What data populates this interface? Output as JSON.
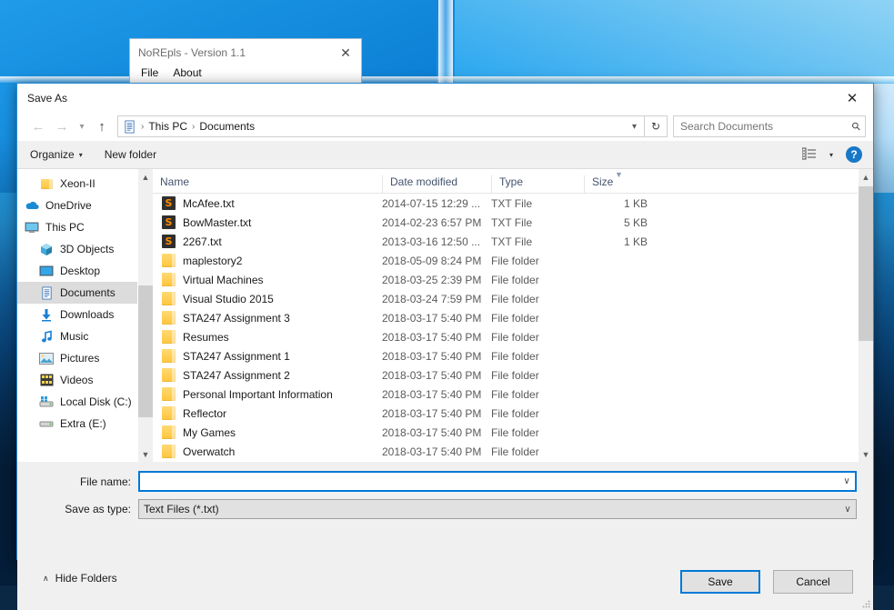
{
  "desktop": {
    "wallpaper_top": "#1b9ae8",
    "wallpaper_bottom": "#04203f"
  },
  "background_window": {
    "title": "NoREpls - Version 1.1",
    "close_icon": "close-icon",
    "menu": [
      {
        "label": "File"
      },
      {
        "label": "About"
      }
    ]
  },
  "dialog": {
    "title": "Save As",
    "close_icon": "close-icon",
    "accent": "#0078d7",
    "nav": {
      "back_icon": "arrow-left-icon",
      "forward_icon": "arrow-right-icon",
      "history_icon": "chevron-down-icon",
      "up_icon": "arrow-up-icon",
      "address_icon": "documents-icon",
      "breadcrumbs": [
        "This PC",
        "Documents"
      ],
      "separator": "›",
      "dropdown_icon": "chevron-down-icon",
      "refresh_icon": "refresh-icon",
      "refresh_glyph": "↻"
    },
    "search": {
      "placeholder": "Search Documents",
      "value": "",
      "icon": "search-icon"
    },
    "commandbar": {
      "organize_label": "Organize",
      "organize_caret": "▾",
      "new_folder_label": "New folder",
      "view_icon": "view-options-icon",
      "view_caret": "▾",
      "help_icon": "help-icon",
      "help_glyph": "?"
    },
    "sidebar": {
      "items": [
        {
          "label": "Xeon-II",
          "icon": "folder-icon",
          "indent": true,
          "selected": false
        },
        {
          "label": "OneDrive",
          "icon": "onedrive-icon",
          "indent": false,
          "selected": false
        },
        {
          "label": "This PC",
          "icon": "this-pc-icon",
          "indent": false,
          "selected": false
        },
        {
          "label": "3D Objects",
          "icon": "3d-objects-icon",
          "indent": true,
          "selected": false
        },
        {
          "label": "Desktop",
          "icon": "desktop-icon",
          "indent": true,
          "selected": false
        },
        {
          "label": "Documents",
          "icon": "documents-icon",
          "indent": true,
          "selected": true
        },
        {
          "label": "Downloads",
          "icon": "downloads-icon",
          "indent": true,
          "selected": false
        },
        {
          "label": "Music",
          "icon": "music-icon",
          "indent": true,
          "selected": false
        },
        {
          "label": "Pictures",
          "icon": "pictures-icon",
          "indent": true,
          "selected": false
        },
        {
          "label": "Videos",
          "icon": "videos-icon",
          "indent": true,
          "selected": false
        },
        {
          "label": "Local Disk (C:)",
          "icon": "local-disk-icon",
          "indent": true,
          "selected": false
        },
        {
          "label": "Extra (E:)",
          "icon": "drive-icon",
          "indent": true,
          "selected": false
        }
      ],
      "scrollbar": {
        "up_icon": "chevron-up-icon",
        "down_icon": "chevron-down-icon"
      }
    },
    "filelist": {
      "columns": [
        {
          "label": "Name"
        },
        {
          "label": "Date modified",
          "sorted": true,
          "sort_icon": "sort-ascending-icon"
        },
        {
          "label": "Type"
        },
        {
          "label": "Size"
        }
      ],
      "rows": [
        {
          "name": "McAfee.txt",
          "date": "2014-07-15 12:29 ...",
          "type": "TXT File",
          "size": "1 KB",
          "icon": "text-file-icon"
        },
        {
          "name": "BowMaster.txt",
          "date": "2014-02-23 6:57 PM",
          "type": "TXT File",
          "size": "5 KB",
          "icon": "text-file-icon"
        },
        {
          "name": "2267.txt",
          "date": "2013-03-16 12:50 ...",
          "type": "TXT File",
          "size": "1 KB",
          "icon": "text-file-icon"
        },
        {
          "name": "maplestory2",
          "date": "2018-05-09 8:24 PM",
          "type": "File folder",
          "size": "",
          "icon": "folder-icon"
        },
        {
          "name": "Virtual Machines",
          "date": "2018-03-25 2:39 PM",
          "type": "File folder",
          "size": "",
          "icon": "folder-icon"
        },
        {
          "name": "Visual Studio 2015",
          "date": "2018-03-24 7:59 PM",
          "type": "File folder",
          "size": "",
          "icon": "folder-icon"
        },
        {
          "name": "STA247 Assignment 3",
          "date": "2018-03-17 5:40 PM",
          "type": "File folder",
          "size": "",
          "icon": "folder-icon"
        },
        {
          "name": "Resumes",
          "date": "2018-03-17 5:40 PM",
          "type": "File folder",
          "size": "",
          "icon": "folder-icon"
        },
        {
          "name": "STA247 Assignment 1",
          "date": "2018-03-17 5:40 PM",
          "type": "File folder",
          "size": "",
          "icon": "folder-icon"
        },
        {
          "name": "STA247 Assignment 2",
          "date": "2018-03-17 5:40 PM",
          "type": "File folder",
          "size": "",
          "icon": "folder-icon"
        },
        {
          "name": "Personal Important Information",
          "date": "2018-03-17 5:40 PM",
          "type": "File folder",
          "size": "",
          "icon": "folder-icon"
        },
        {
          "name": "Reflector",
          "date": "2018-03-17 5:40 PM",
          "type": "File folder",
          "size": "",
          "icon": "folder-icon"
        },
        {
          "name": "My Games",
          "date": "2018-03-17 5:40 PM",
          "type": "File folder",
          "size": "",
          "icon": "folder-icon"
        },
        {
          "name": "Overwatch",
          "date": "2018-03-17 5:40 PM",
          "type": "File folder",
          "size": "",
          "icon": "folder-icon"
        }
      ],
      "scrollbar": {
        "up_icon": "chevron-up-icon",
        "down_icon": "chevron-down-icon"
      }
    },
    "form": {
      "filename_label": "File name:",
      "filename_value": "",
      "filename_caret": "∨",
      "savetype_label": "Save as type:",
      "savetype_value": "Text Files (*.txt)",
      "savetype_caret": "∨",
      "hide_folders_label": "Hide Folders",
      "hide_folders_caret": "∧",
      "save_label": "Save",
      "cancel_label": "Cancel"
    }
  }
}
